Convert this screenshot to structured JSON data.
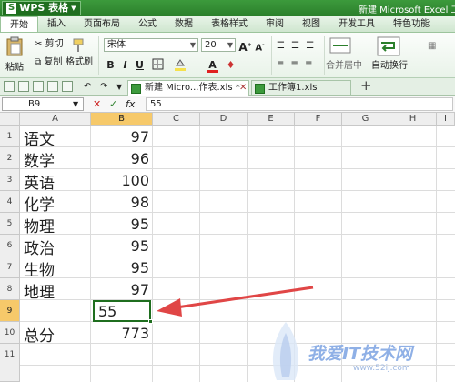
{
  "title": {
    "app_name": "WPS 表格",
    "logo_letter": "S",
    "window_title": "新建 Microsoft Excel 工作"
  },
  "menu": [
    "开始",
    "插入",
    "页面布局",
    "公式",
    "数据",
    "表格样式",
    "审阅",
    "视图",
    "开发工具",
    "特色功能"
  ],
  "ribbon": {
    "cut": "剪切",
    "paste": "粘贴",
    "copy": "复制",
    "format_painter": "格式刷",
    "font_name": "宋体",
    "font_size": "20",
    "bold": "B",
    "italic": "I",
    "underline": "U",
    "merge_center": "合并居中",
    "wrap_text": "自动换行"
  },
  "tabs": [
    {
      "label": "新建 Micro...作表.xls *",
      "active": true
    },
    {
      "label": "工作簿1.xls",
      "active": false
    }
  ],
  "new_tab": "+",
  "formula_bar": {
    "name_box": "B9",
    "fx": "fx",
    "value": "55",
    "cancel": "✕",
    "confirm": "✓"
  },
  "columns": [
    "A",
    "B",
    "C",
    "D",
    "E",
    "F",
    "G",
    "H",
    "I"
  ],
  "rows": [
    "1",
    "2",
    "3",
    "4",
    "5",
    "6",
    "7",
    "8",
    "9",
    "10",
    "11"
  ],
  "cells": [
    {
      "a": "语文",
      "b": "97"
    },
    {
      "a": "数学",
      "b": "96"
    },
    {
      "a": "英语",
      "b": "100"
    },
    {
      "a": "化学",
      "b": "98"
    },
    {
      "a": "物理",
      "b": "95"
    },
    {
      "a": "政治",
      "b": "95"
    },
    {
      "a": "生物",
      "b": "95"
    },
    {
      "a": "地理",
      "b": "97"
    },
    {
      "a": "",
      "b": "55"
    },
    {
      "a": "总分",
      "b": "773"
    }
  ],
  "selected_cell": "B9",
  "watermark": {
    "text": "我爱IT技术网",
    "url": "www.52ij.com"
  },
  "colors": {
    "accent": "#2b7f2b",
    "arrow": "#e04646",
    "selection_header": "#f6c96a"
  }
}
